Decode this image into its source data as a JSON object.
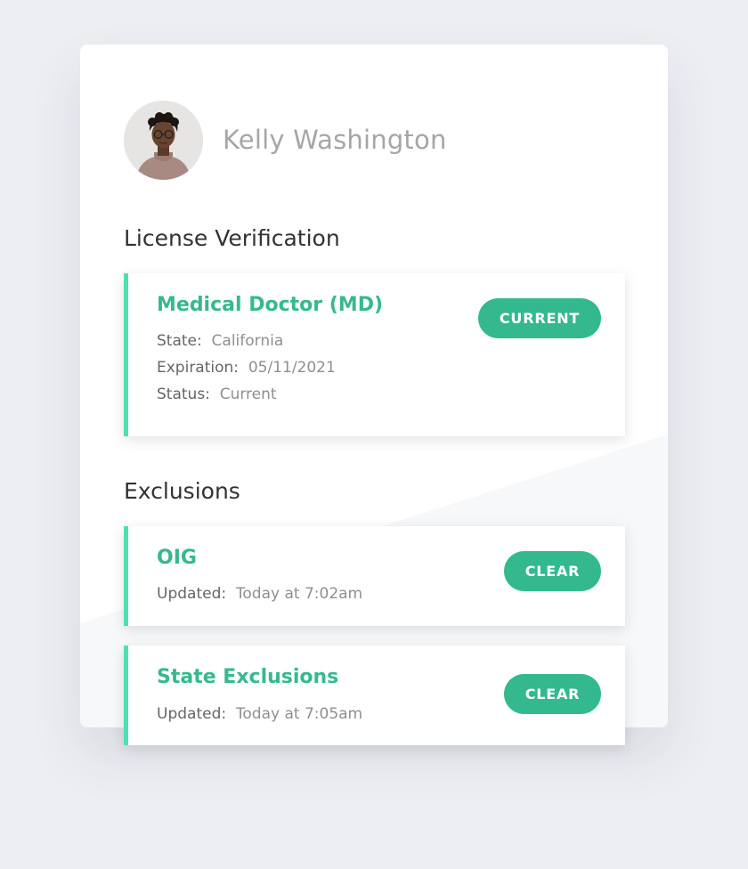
{
  "profile": {
    "name": "Kelly Washington",
    "avatar_alt": "Kelly Washington"
  },
  "license": {
    "heading": "License Verification",
    "card": {
      "title": "Medical Doctor (MD)",
      "badge": "CURRENT",
      "fields": [
        {
          "label": "State:",
          "value": "California"
        },
        {
          "label": "Expiration:",
          "value": "05/11/2021"
        },
        {
          "label": "Status:",
          "value": "Current"
        }
      ]
    }
  },
  "exclusions": {
    "heading": "Exclusions",
    "cards": [
      {
        "title": "OIG",
        "badge": "CLEAR",
        "label": "Updated:",
        "value": "Today at 7:02am"
      },
      {
        "title": "State Exclusions",
        "badge": "CLEAR",
        "label": "Updated:",
        "value": "Today at 7:05am"
      }
    ]
  },
  "colors": {
    "accent": "#36b98e",
    "badge": "#34b98f",
    "card_border": "#4fe0b0",
    "background": "#eceef2"
  }
}
